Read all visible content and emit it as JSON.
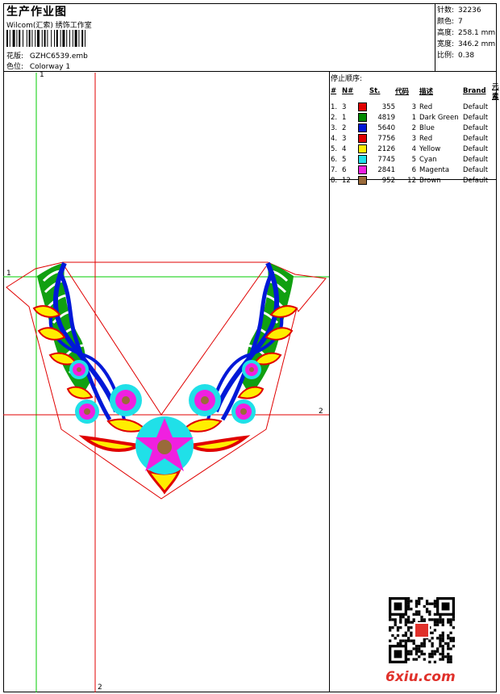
{
  "header": {
    "title": "生产作业图",
    "subtitle": "Wilcom(汇索) 绣饰工作室",
    "design_label": "花版:",
    "design_value": "GZHC6539.emb",
    "colorway_label": "色位:",
    "colorway_value": "Colorway 1"
  },
  "stats": {
    "stitches_label": "针数:",
    "stitches_value": "32236",
    "colors_label": "颜色:",
    "colors_value": "7",
    "height_label": "高度:",
    "height_value": "258.1 mm",
    "width_label": "宽度:",
    "width_value": "346.2 mm",
    "scale_label": "比例:",
    "scale_value": "0.38"
  },
  "stop_sequence": {
    "title": "停止顺序:",
    "columns": [
      "#",
      "N#",
      "St.",
      "代码",
      "描述",
      "Brand",
      "元素"
    ],
    "rows": [
      {
        "idx": "1.",
        "n": "3",
        "color": "#e00000",
        "st": "355",
        "code": "3",
        "desc": "Red",
        "brand": "Default"
      },
      {
        "idx": "2.",
        "n": "1",
        "color": "#008a00",
        "st": "4819",
        "code": "1",
        "desc": "Dark Green",
        "brand": "Default"
      },
      {
        "idx": "3.",
        "n": "2",
        "color": "#0018d8",
        "st": "5640",
        "code": "2",
        "desc": "Blue",
        "brand": "Default"
      },
      {
        "idx": "4.",
        "n": "3",
        "color": "#e00000",
        "st": "7756",
        "code": "3",
        "desc": "Red",
        "brand": "Default"
      },
      {
        "idx": "5.",
        "n": "4",
        "color": "#ffee00",
        "st": "2126",
        "code": "4",
        "desc": "Yellow",
        "brand": "Default"
      },
      {
        "idx": "6.",
        "n": "5",
        "color": "#20e0e8",
        "st": "7745",
        "code": "5",
        "desc": "Cyan",
        "brand": "Default"
      },
      {
        "idx": "7.",
        "n": "6",
        "color": "#f020e0",
        "st": "2841",
        "code": "6",
        "desc": "Magenta",
        "brand": "Default"
      },
      {
        "idx": "8.",
        "n": "12",
        "color": "#9a6a3a",
        "st": "952",
        "code": "12",
        "desc": "Brown",
        "brand": "Default"
      }
    ]
  },
  "guides": {
    "v1_label": "1",
    "h1_label": "1",
    "h2_label": "2",
    "v2_label": "2"
  },
  "watermark": {
    "text": "6xiu.com"
  }
}
